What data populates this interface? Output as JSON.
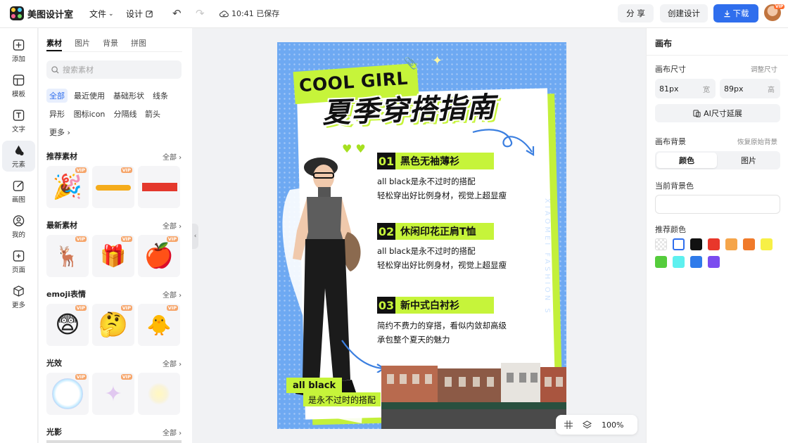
{
  "app": {
    "name": "美图设计室",
    "save_status": "10:41 已保存"
  },
  "topbar": {
    "file_menu": "文件",
    "design_menu": "设计",
    "share": "分 享",
    "create_design": "创建设计",
    "download": "下载",
    "vip_badge": "VIP"
  },
  "nav": [
    {
      "label": "添加",
      "icon": "plus-square-icon"
    },
    {
      "label": "模板",
      "icon": "template-icon"
    },
    {
      "label": "文字",
      "icon": "text-icon"
    },
    {
      "label": "元素",
      "icon": "element-icon",
      "active": true
    },
    {
      "label": "画图",
      "icon": "draw-icon"
    },
    {
      "label": "我的",
      "icon": "user-icon"
    },
    {
      "label": "页面",
      "icon": "page-icon"
    },
    {
      "label": "更多",
      "icon": "cube-icon"
    }
  ],
  "material_panel": {
    "tabs": [
      "素材",
      "图片",
      "背景",
      "拼图"
    ],
    "search_placeholder": "搜索素材",
    "chips": [
      "全部",
      "最近使用",
      "基础形状",
      "线条",
      "异形",
      "图标icon",
      "分隔线",
      "箭头",
      "更多"
    ],
    "all_label": "全部",
    "vip_label": "VIP",
    "sections": [
      {
        "title": "推荐素材",
        "items": [
          "party-popper",
          "yellow-brush-stroke",
          "red-rectangle"
        ]
      },
      {
        "title": "最新素材",
        "items": [
          "reindeer-sleigh",
          "snow-globe-gift",
          "red-apple"
        ]
      },
      {
        "title": "emoji表情",
        "items": [
          "shocked-emoji",
          "thinking-emoji",
          "checklist-chick-emoji"
        ]
      },
      {
        "title": "光效",
        "items": [
          "rainbow-bubble",
          "sparkle-star",
          "glow-light"
        ]
      },
      {
        "title": "光影",
        "items": []
      }
    ]
  },
  "poster": {
    "cool_text": "COOL GIRL",
    "title": "夏季穿搭指南",
    "items": [
      {
        "num": "01",
        "heading": "黑色无袖薄衫",
        "line1": "all black是永不过时的搭配",
        "line2": "轻松穿出好比例身材，视觉上超显瘦"
      },
      {
        "num": "02",
        "heading": "休闲印花正肩T恤",
        "line1": "all black是永不过时的搭配",
        "line2": "轻松穿出好比例身材，视觉上超显瘦"
      },
      {
        "num": "03",
        "heading": "新中式白衬衫",
        "line1": "简约不费力的穿搭，看似内敛却高级",
        "line2": "承包整个夏天的魅力"
      }
    ],
    "vertical_text": "XIAOMEI FASHION S",
    "tag_main": "all black",
    "tag_sub": "是永不过时的搭配",
    "accent": "#c6f43a",
    "background": "#6ea9f2"
  },
  "zoom": {
    "level": "100%"
  },
  "right_panel": {
    "title": "画布",
    "size_label": "画布尺寸",
    "adjust_size": "调整尺寸",
    "width_value": "81px",
    "width_unit": "宽",
    "height_value": "89px",
    "height_unit": "高",
    "ai_extend": "AI尺寸延展",
    "bg_label": "画布背景",
    "restore_bg": "恢复原始背景",
    "bg_tabs": [
      "颜色",
      "图片"
    ],
    "current_bg_label": "当前背景色",
    "recommend_label": "推荐颜色",
    "swatches": [
      "transparent",
      "#ffffff",
      "#111111",
      "#e8372b",
      "#f5a54a",
      "#f07a2a",
      "#f7f046",
      "#55cc3c",
      "#5ef0ef",
      "#2f7bea",
      "#7b4cef"
    ]
  }
}
